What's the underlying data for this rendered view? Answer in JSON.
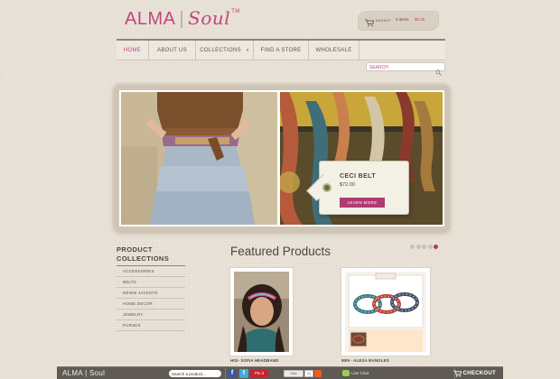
{
  "brand": {
    "name": "ALMA",
    "separator": "|",
    "sub": "Soul",
    "tm": "TM"
  },
  "basket": {
    "label": "BASKET",
    "items": "0 items",
    "total": "$0.00"
  },
  "nav": [
    {
      "label": "HOME",
      "active": true
    },
    {
      "label": "ABOUT US"
    },
    {
      "label": "COLLECTIONS",
      "dropdown": true
    },
    {
      "label": "FIND A STORE"
    },
    {
      "label": "WHOLESALE"
    }
  ],
  "search": {
    "placeholder": "SEARCH"
  },
  "slider": {
    "caption_title": "CECI BELT",
    "caption_price": "$72.00",
    "button": "LEARN MORE",
    "dots": 5,
    "active_dot": 5
  },
  "sidebar": {
    "title": "PRODUCT\nCOLLECTIONS",
    "items": [
      "ACCESSORIES",
      "BELTS",
      "DENIM JACKETS",
      "HOME DECOR",
      "JEWELRY",
      "PURSES"
    ]
  },
  "featured": {
    "title": "Featured Products",
    "products": [
      {
        "name": "H02- SOFIA HEADBAND"
      },
      {
        "name": "M09 - ALEXA BANGLES"
      }
    ]
  },
  "footer": {
    "brand": "ALMA | Soul",
    "search_placeholder": "Search a product...",
    "facebook": "f",
    "twitter": "t",
    "pinterest": "Pin it",
    "like": "Like",
    "like_count": "11",
    "live_chat": "Live Chat",
    "checkout": "CHECKOUT"
  },
  "colors": {
    "accent": "#c2457f",
    "button": "#b03a72",
    "footer": "#5f5a54"
  }
}
